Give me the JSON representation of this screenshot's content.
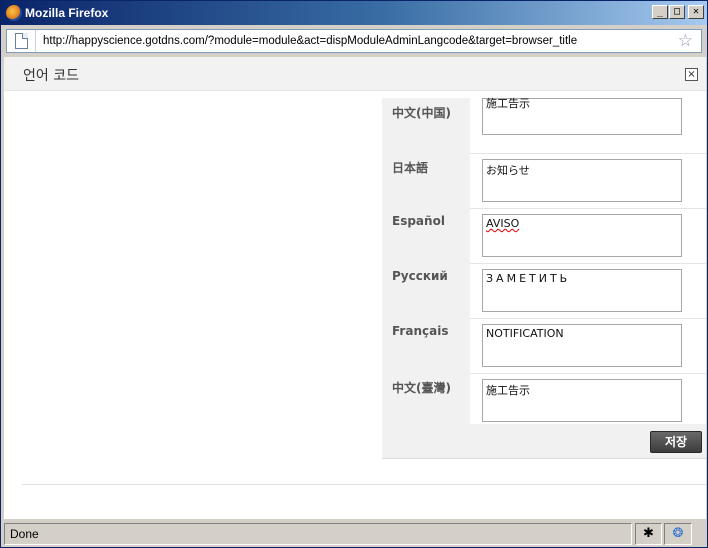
{
  "window": {
    "title": "Mozilla Firefox",
    "url": "http://happyscience.gotdns.com/?module=module&act=dispModuleAdminLangcode&target=browser_title",
    "controls": {
      "minimize": "_",
      "maximize": "□",
      "close": "✕"
    }
  },
  "modal": {
    "title": "언어 코드",
    "close_label": "×"
  },
  "lang_rows": [
    {
      "label": "中文(中国)",
      "value": "施工告示"
    },
    {
      "label": "日本語",
      "value": "お知らせ"
    },
    {
      "label": "Español",
      "value": "AVISO"
    },
    {
      "label": "Русский",
      "value": "ЗАМЕТИТЬ"
    },
    {
      "label": "Français",
      "value": "NOTIFICATION"
    },
    {
      "label": "中文(臺灣)",
      "value": "施工告示"
    }
  ],
  "save_label": "저장",
  "status": {
    "text": "Done"
  },
  "icons": {
    "bookmark_star": "☆",
    "status_bug": "✱",
    "status_globe": "❂"
  }
}
